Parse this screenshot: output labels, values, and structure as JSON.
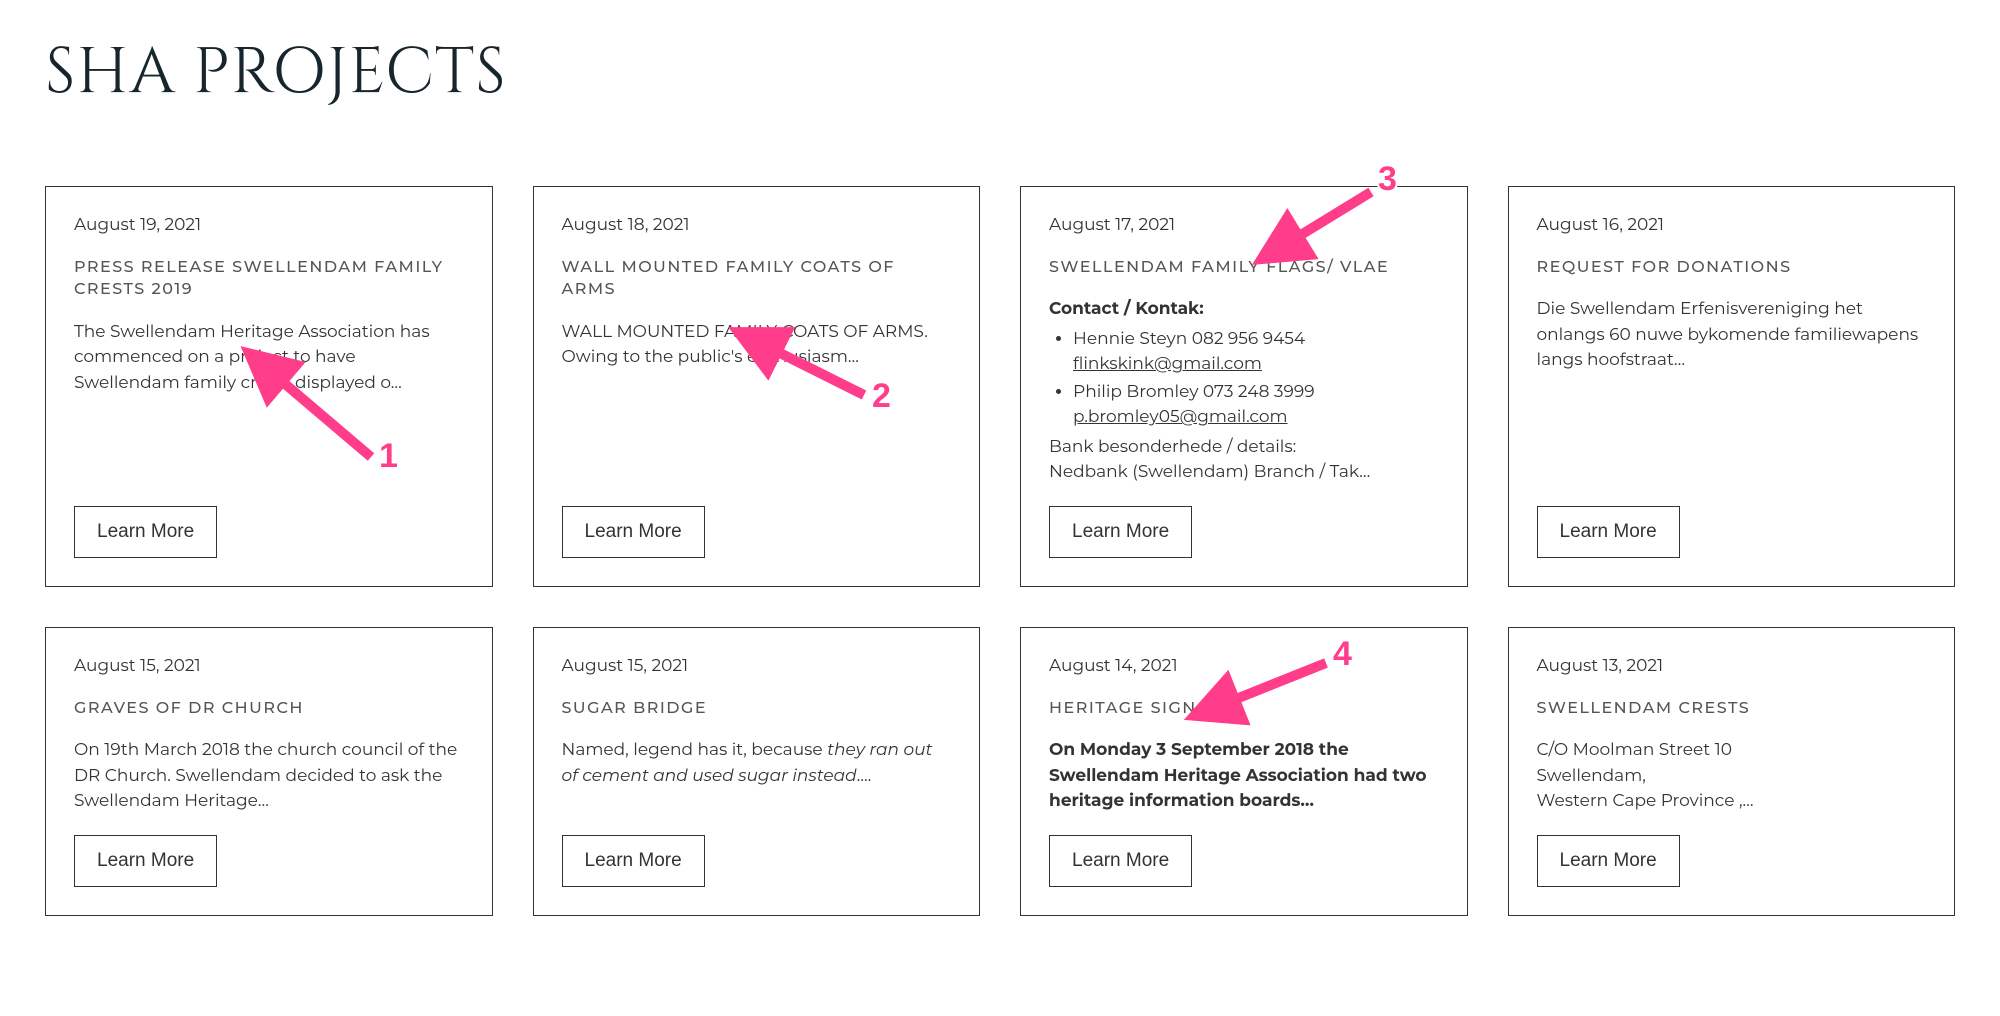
{
  "page": {
    "title": "SHA PROJECTS"
  },
  "learn_more_label": "Learn More",
  "cards": [
    {
      "date": "August 19, 2021",
      "title": "PRESS RELEASE SWELLENDAM FAMILY CRESTS 2019",
      "body": "The Swellendam Heritage Association has commenced on a project to have Swellendam family crests displayed o…"
    },
    {
      "date": "August 18, 2021",
      "title": "WALL MOUNTED FAMILY COATS OF ARMS",
      "body_line1": "WALL MOUNTED FAMILY COATS OF ARMS.",
      "body_line2": "Owing to the public's enthusiasm…"
    },
    {
      "date": "August 17, 2021",
      "title": "SWELLENDAM FAMILY FLAGS/ VLAE",
      "contact_label": "Contact / Kontak:",
      "contact1_name": "Hennie Steyn 082 956 9454",
      "contact1_email": "flinkskink@gmail.com",
      "contact2_name": "Philip Bromley 073 248 3999",
      "contact2_email": "p.bromley05@gmail.com",
      "bank_line1": "Bank besonderhede / details:",
      "bank_line2": "Nedbank (Swellendam) Branch / Tak…"
    },
    {
      "date": "August 16, 2021",
      "title": "REQUEST FOR DONATIONS",
      "body": "Die Swellendam Erfenisvereniging het onlangs 60 nuwe bykomende familiewapens langs hoofstraat…"
    },
    {
      "date": "August 15, 2021",
      "title": "GRAVES OF DR CHURCH",
      "body": "On 19th March 2018 the church council of the DR Church. Swellendam decided to ask the Swellendam Heritage…"
    },
    {
      "date": "August 15, 2021",
      "title": "SUGAR BRIDGE",
      "body_pre": "Named, legend has it, because ",
      "body_em": "they ran out of cement and used sugar instead",
      "body_post": "…."
    },
    {
      "date": "August 14, 2021",
      "title": "HERITAGE SIGNAGE",
      "body_bold": "On Monday 3 September 2018 the Swellendam Heritage Association had two heritage information boards…"
    },
    {
      "date": "August 13, 2021",
      "title": "SWELLENDAM CRESTS",
      "body_line1": "C/O Moolman Street 10",
      "body_line2": "Swellendam,",
      "body_line3": "Western Cape Province ,…"
    }
  ],
  "annotations": [
    {
      "num": "1"
    },
    {
      "num": "2"
    },
    {
      "num": "3"
    },
    {
      "num": "4"
    }
  ]
}
